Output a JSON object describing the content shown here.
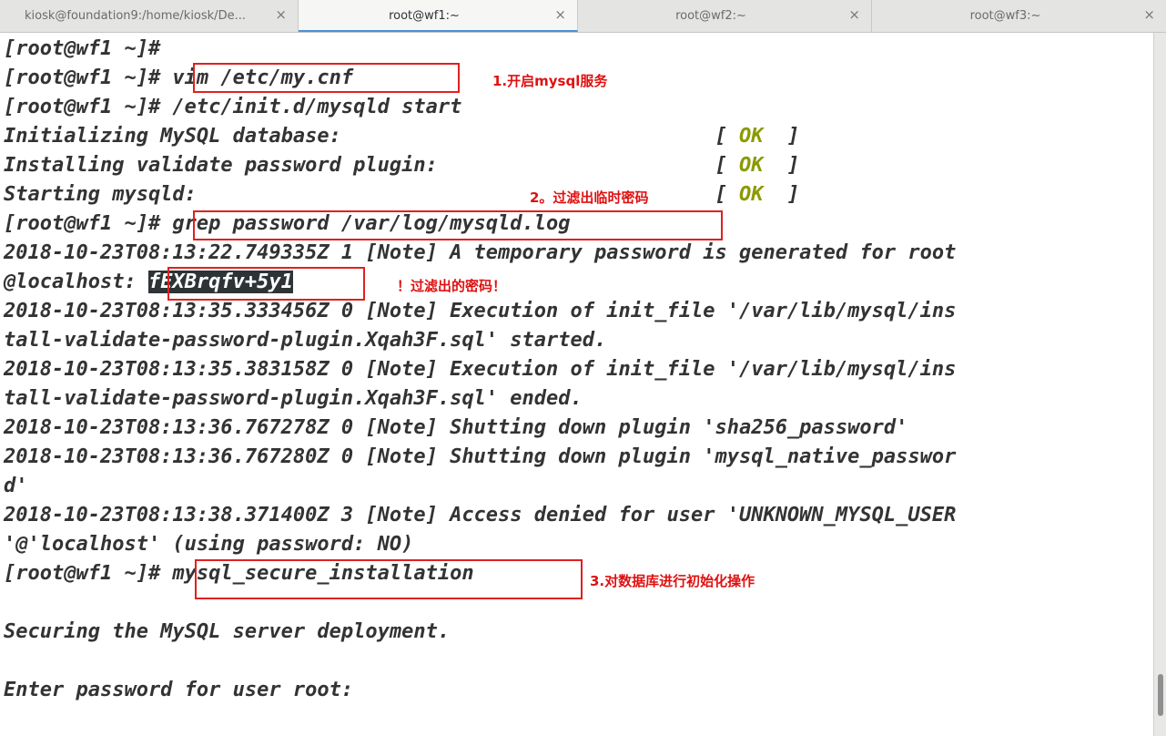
{
  "tabs": [
    {
      "label": "kiosk@foundation9:/home/kiosk/De...",
      "active": false
    },
    {
      "label": "root@wf1:~",
      "active": true
    },
    {
      "label": "root@wf2:~",
      "active": false
    },
    {
      "label": "root@wf3:~",
      "active": false
    }
  ],
  "close_glyph": "×",
  "terminal": {
    "l1": "[root@wf1 ~]#",
    "l2": "[root@wf1 ~]# vim /etc/my.cnf",
    "l3": "[root@wf1 ~]# /etc/init.d/mysqld start",
    "l4_text": "Initializing MySQL database:                               [ ",
    "l5_text": "Installing validate password plugin:                       [ ",
    "l6_text": "Starting mysqld:                                           [ ",
    "ok": "OK",
    "ok_close": "  ]",
    "l7": "[root@wf1 ~]# grep password /var/log/mysqld.log",
    "l8": "2018-10-23T08:13:22.749335Z 1 [Note] A temporary password is generated for root",
    "l9_prefix": "@localhost: ",
    "temp_password": "fEXBrqfv+5y1",
    "l10": "2018-10-23T08:13:35.333456Z 0 [Note] Execution of init_file '/var/lib/mysql/ins",
    "l11": "tall-validate-password-plugin.Xqah3F.sql' started.",
    "l12": "2018-10-23T08:13:35.383158Z 0 [Note] Execution of init_file '/var/lib/mysql/ins",
    "l13": "tall-validate-password-plugin.Xqah3F.sql' ended.",
    "l14": "2018-10-23T08:13:36.767278Z 0 [Note] Shutting down plugin 'sha256_password'",
    "l15": "2018-10-23T08:13:36.767280Z 0 [Note] Shutting down plugin 'mysql_native_passwor",
    "l16": "d'",
    "l17": "2018-10-23T08:13:38.371400Z 3 [Note] Access denied for user 'UNKNOWN_MYSQL_USER",
    "l18": "'@'localhost' (using password: NO)",
    "l19": "[root@wf1 ~]# mysql_secure_installation",
    "l21": "Securing the MySQL server deployment.",
    "l23": "Enter password for user root:"
  },
  "annotations": {
    "a1": "1.开启mysql服务",
    "a2": "2。过滤出临时密码",
    "a3": "！过滤出的密码！",
    "a4": "3.对数据库进行初始化操作"
  },
  "colors": {
    "annotation": "#e01010",
    "ok": "#8a9a00",
    "terminal_text": "#333333"
  }
}
